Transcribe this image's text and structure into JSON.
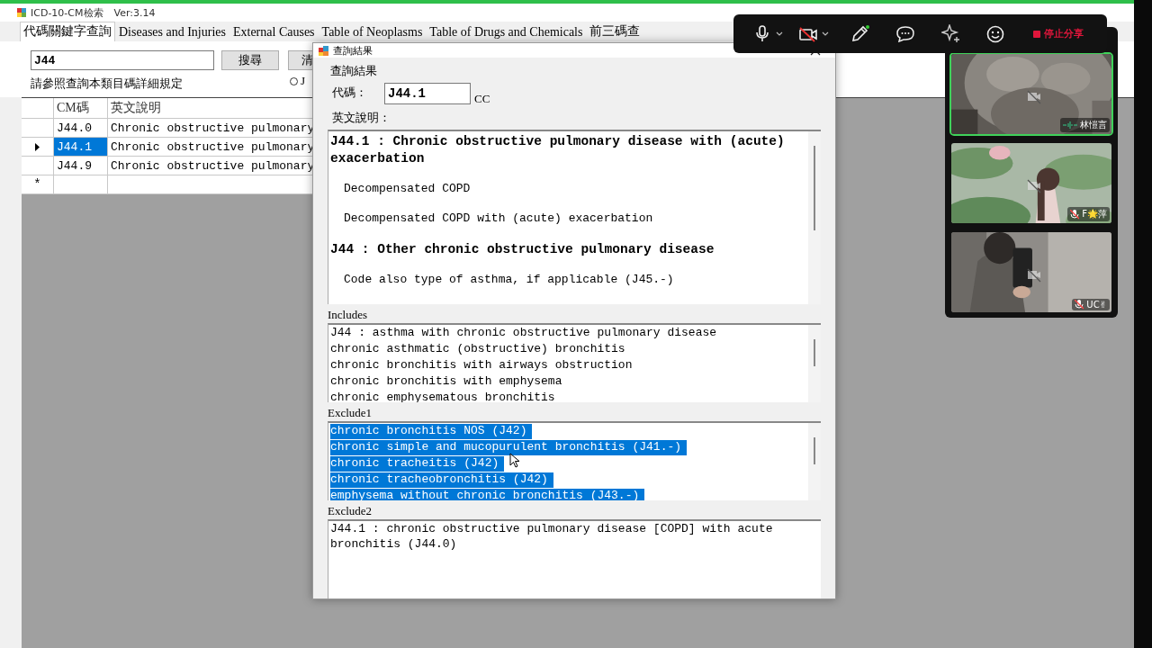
{
  "window": {
    "title": "ICD-10-CM檢索",
    "version": "Ver:3.14"
  },
  "tabs": [
    {
      "label": "代碼關鍵字查詢",
      "selected": true
    },
    {
      "label": "Diseases and Injuries",
      "selected": false
    },
    {
      "label": "External Causes",
      "selected": false
    },
    {
      "label": "Table of Neoplasms",
      "selected": false
    },
    {
      "label": "Table of Drugs and Chemicals",
      "selected": false
    },
    {
      "label": "前三碼查",
      "selected": false
    }
  ],
  "search": {
    "value": "J44",
    "buttons": [
      "搜尋",
      "清"
    ],
    "note": "請參照查詢本類目碼詳細規定",
    "radio": {
      "label": "J",
      "selected": false
    }
  },
  "grid": {
    "columns": [
      "CM碼",
      "英文說明"
    ],
    "rows": [
      {
        "code": "J44.0",
        "description": "Chronic obstructive pulmonary",
        "selected": false
      },
      {
        "code": "J44.1",
        "description": "Chronic obstructive pulmonary",
        "selected": true
      },
      {
        "code": "J44.9",
        "description": "Chronic obstructive pulmonary",
        "selected": false
      }
    ],
    "new_row_marker": "*"
  },
  "dialog": {
    "title": "查詢結果",
    "group_label": "查詢結果",
    "code_label": "代碼：",
    "code": "J44.1",
    "cc": "CC",
    "description_label": "英文說明：",
    "description": [
      {
        "kind": "heading",
        "text": "J44.1 : Chronic obstructive pulmonary disease with (acute) exacerbation"
      },
      {
        "kind": "note",
        "text": "Decompensated COPD"
      },
      {
        "kind": "note",
        "text": "Decompensated COPD with (acute) exacerbation"
      },
      {
        "kind": "heading",
        "text": "J44 : Other chronic obstructive pulmonary disease"
      },
      {
        "kind": "note",
        "text": "Code also type of asthma, if applicable (J45.-)"
      }
    ],
    "sections": [
      {
        "label": "Includes",
        "lines": [
          {
            "text": "J44 : asthma with chronic obstructive pulmonary disease",
            "selected": false
          },
          {
            "text": "chronic asthmatic (obstructive) bronchitis",
            "selected": false
          },
          {
            "text": "chronic bronchitis with airways obstruction",
            "selected": false
          },
          {
            "text": "chronic bronchitis with emphysema",
            "selected": false
          },
          {
            "text": "chronic emphysematous bronchitis",
            "selected": false
          }
        ]
      },
      {
        "label": "Exclude1",
        "lines": [
          {
            "text": "chronic bronchitis NOS (J42)",
            "selected": true
          },
          {
            "text": "chronic simple and mucopurulent bronchitis (J41.-)",
            "selected": true
          },
          {
            "text": "chronic tracheitis (J42)",
            "selected": true
          },
          {
            "text": "chronic tracheobronchitis (J42)",
            "selected": true
          },
          {
            "text": "emphysema without chronic bronchitis (J43.-)",
            "selected": true
          }
        ]
      },
      {
        "label": "Exclude2",
        "lines": [
          {
            "text": "J44.1 : chronic obstructive pulmonary disease [COPD] with acute bronchitis (J44.0)",
            "selected": false
          }
        ]
      }
    ]
  },
  "meeting": {
    "stop_label": "停止分享",
    "participants": [
      {
        "name": "林愷言",
        "active": true,
        "muted": false
      },
      {
        "name": "F🌟萍",
        "active": false,
        "muted": true
      },
      {
        "name": "UC✌",
        "active": false,
        "muted": true
      }
    ]
  }
}
